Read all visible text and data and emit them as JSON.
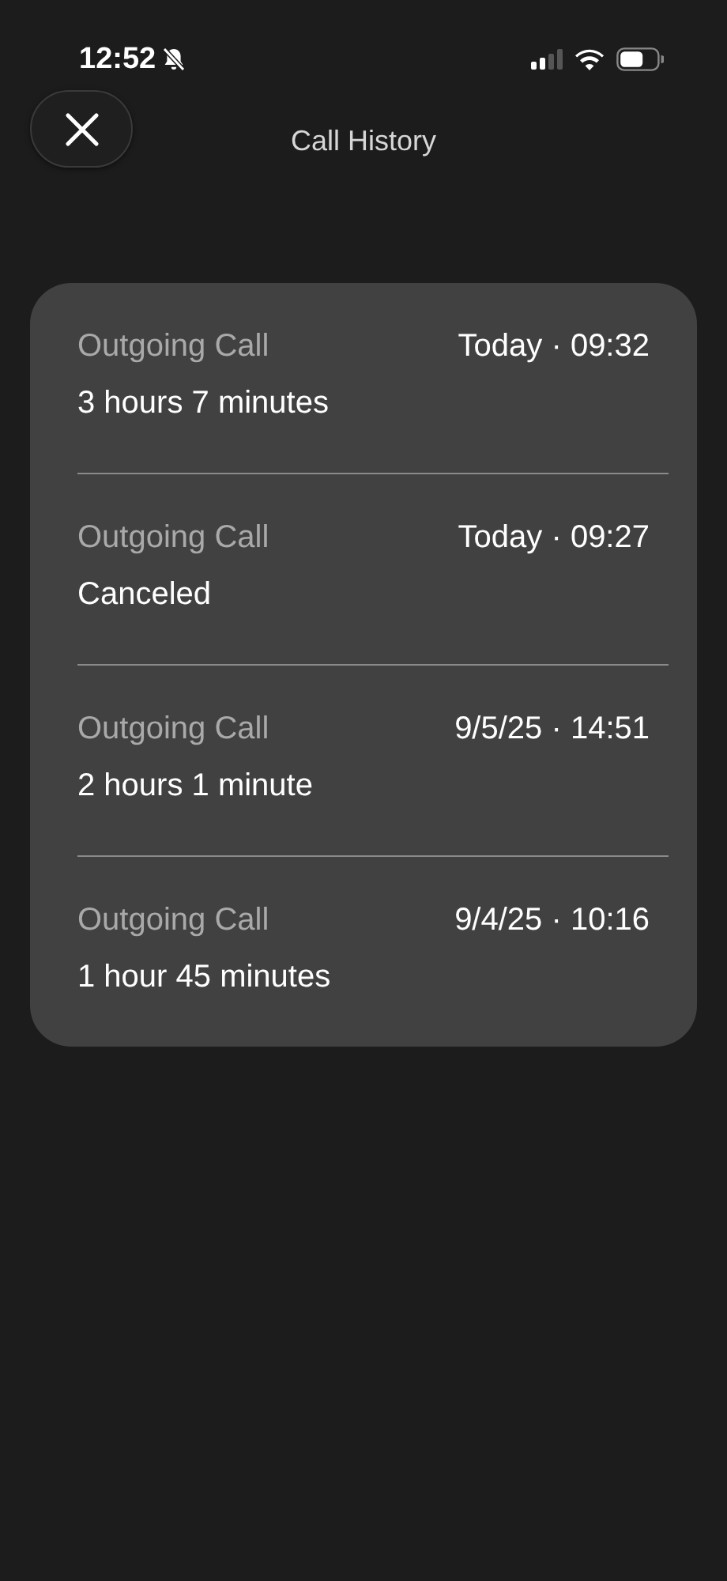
{
  "status_bar": {
    "time": "12:52"
  },
  "header": {
    "title": "Call History"
  },
  "calls": [
    {
      "type": "Outgoing Call",
      "when": "Today · 09:32",
      "detail": "3 hours 7 minutes"
    },
    {
      "type": "Outgoing Call",
      "when": "Today · 09:27",
      "detail": "Canceled"
    },
    {
      "type": "Outgoing Call",
      "when": "9/5/25 · 14:51",
      "detail": "2 hours 1 minute"
    },
    {
      "type": "Outgoing Call",
      "when": "9/4/25 · 10:16",
      "detail": "1 hour 45 minutes"
    }
  ]
}
